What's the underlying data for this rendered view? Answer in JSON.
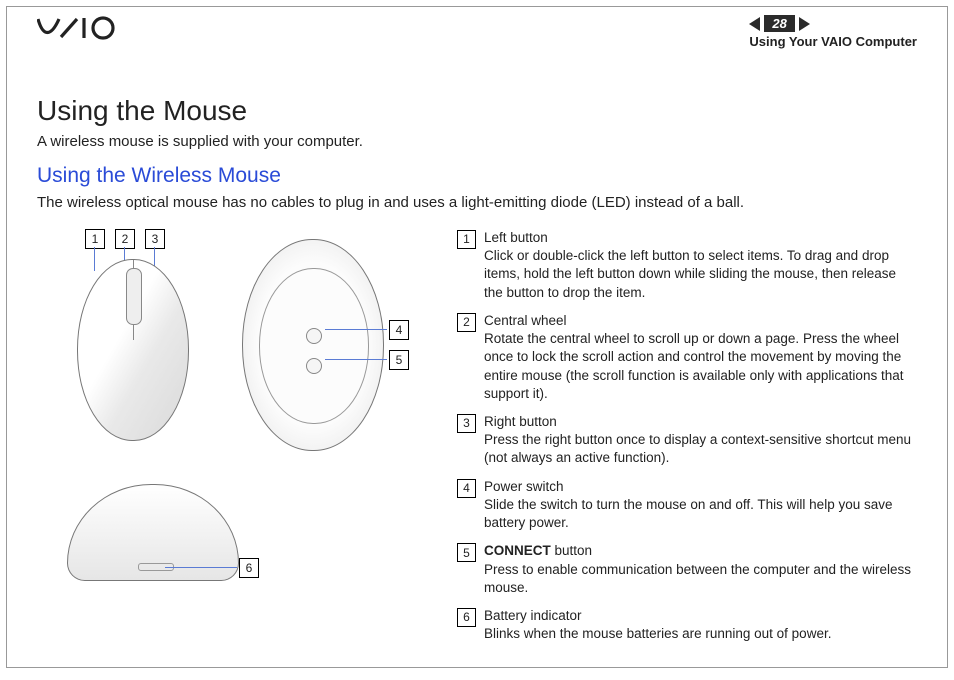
{
  "header": {
    "page_number": "28",
    "breadcrumb": "Using Your VAIO Computer"
  },
  "title": "Using the Mouse",
  "lead": "A wireless mouse is supplied with your computer.",
  "subtitle": "Using the Wireless Mouse",
  "subtext": "The wireless optical mouse has no cables to plug in and uses a light-emitting diode (LED) instead of a ball.",
  "callouts": {
    "c1": "1",
    "c2": "2",
    "c3": "3",
    "c4": "4",
    "c5": "5",
    "c6": "6"
  },
  "items": [
    {
      "n": "1",
      "title": "Left button",
      "desc": "Click or double-click the left button to select items. To drag and drop items, hold the left button down while sliding the mouse, then release the button to drop the item."
    },
    {
      "n": "2",
      "title": "Central wheel",
      "desc": "Rotate the central wheel to scroll up or down a page. Press the wheel once to lock the scroll action and control the movement by moving the entire mouse (the scroll function is available only with applications that support it)."
    },
    {
      "n": "3",
      "title": "Right button",
      "desc": "Press the right button once to display a context-sensitive shortcut menu (not always an active function)."
    },
    {
      "n": "4",
      "title": "Power switch",
      "desc": "Slide the switch to turn the mouse on and off. This will help you save battery power."
    },
    {
      "n": "5",
      "title": "CONNECT button",
      "title_bold": "CONNECT",
      "title_rest": " button",
      "desc": "Press to enable communication between the computer and the wireless mouse."
    },
    {
      "n": "6",
      "title": "Battery indicator",
      "desc": "Blinks when the mouse batteries are running out of power."
    }
  ]
}
